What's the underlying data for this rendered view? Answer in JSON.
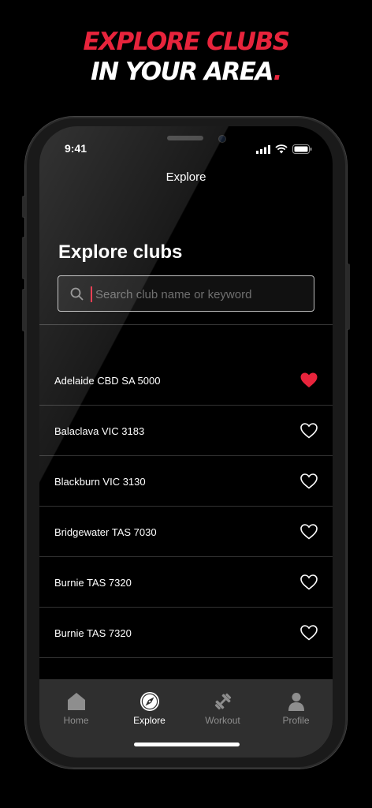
{
  "headline": {
    "line1": "EXPLORE CLUBS",
    "line2": "IN YOUR AREA",
    "dot": "."
  },
  "status": {
    "time": "9:41"
  },
  "nav": {
    "title": "Explore"
  },
  "page": {
    "title": "Explore clubs"
  },
  "search": {
    "placeholder": "Search club name or keyword",
    "value": ""
  },
  "clubs": [
    {
      "name": "Adelaide CBD SA 5000",
      "favorite": true
    },
    {
      "name": "Balaclava VIC 3183",
      "favorite": false
    },
    {
      "name": "Blackburn VIC 3130",
      "favorite": false
    },
    {
      "name": "Bridgewater TAS 7030",
      "favorite": false
    },
    {
      "name": "Burnie TAS 7320",
      "favorite": false
    },
    {
      "name": "Burnie TAS 7320",
      "favorite": false
    }
  ],
  "tabs": [
    {
      "label": "Home",
      "icon": "home-icon",
      "active": false
    },
    {
      "label": "Explore",
      "icon": "compass-icon",
      "active": true
    },
    {
      "label": "Workout",
      "icon": "dumbbell-icon",
      "active": false
    },
    {
      "label": "Profile",
      "icon": "person-icon",
      "active": false
    }
  ],
  "colors": {
    "accent": "#e8243c",
    "background": "#000000",
    "tabbar": "#2f2f2f",
    "inactive": "#8e8e8e"
  }
}
